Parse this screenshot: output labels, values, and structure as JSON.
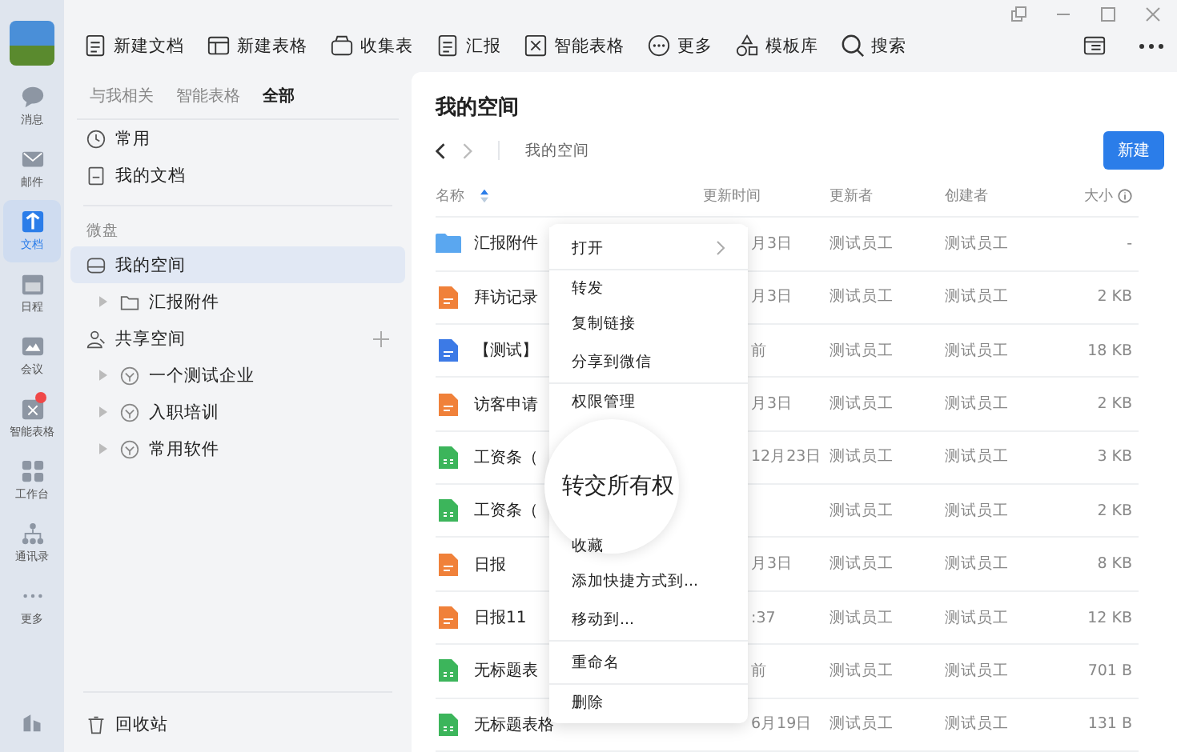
{
  "rail": [
    {
      "kind": "chat",
      "label": "消息",
      "selected": false,
      "badge": false
    },
    {
      "kind": "mail",
      "label": "邮件",
      "selected": false,
      "badge": false
    },
    {
      "kind": "doc",
      "label": "文档",
      "selected": true,
      "badge": false
    },
    {
      "kind": "calendar",
      "label": "日程",
      "selected": false,
      "badge": false
    },
    {
      "kind": "meeting",
      "label": "会议",
      "selected": false,
      "badge": false
    },
    {
      "kind": "sheet",
      "label": "智能表格",
      "selected": false,
      "badge": true
    },
    {
      "kind": "apps",
      "label": "工作台",
      "selected": false,
      "badge": false
    },
    {
      "kind": "contacts",
      "label": "通讯录",
      "selected": false,
      "badge": false
    },
    {
      "kind": "more",
      "label": "更多",
      "selected": false,
      "badge": false
    }
  ],
  "toolbar": [
    {
      "kind": "doc",
      "label": "新建文档"
    },
    {
      "kind": "table",
      "label": "新建表格"
    },
    {
      "kind": "bag",
      "label": "收集表"
    },
    {
      "kind": "report",
      "label": "汇报"
    },
    {
      "kind": "smart",
      "label": "智能表格"
    },
    {
      "kind": "more",
      "label": "更多"
    },
    {
      "kind": "shapes",
      "label": "模板库"
    },
    {
      "kind": "search",
      "label": "搜索"
    }
  ],
  "sidebar": {
    "tabs": [
      {
        "label": "与我相关",
        "selected": false
      },
      {
        "label": "智能表格",
        "selected": false
      },
      {
        "label": "全部",
        "selected": true
      }
    ],
    "quick": [
      {
        "kind": "clock",
        "label": "常用"
      },
      {
        "kind": "doc",
        "label": "我的文档"
      }
    ],
    "section": "微盘",
    "tree": [
      {
        "kind": "drive",
        "label": "我的空间",
        "selected": true,
        "add": false,
        "children": [
          {
            "kind": "folder",
            "label": "汇报附件",
            "selected": false
          }
        ]
      },
      {
        "kind": "shared",
        "label": "共享空间",
        "selected": false,
        "add": true,
        "children": [
          {
            "kind": "space",
            "label": "一个测试企业",
            "selected": false
          },
          {
            "kind": "space",
            "label": "入职培训",
            "selected": false
          },
          {
            "kind": "space",
            "label": "常用软件",
            "selected": false
          }
        ]
      }
    ],
    "trash": "回收站"
  },
  "main": {
    "title": "我的空间",
    "breadcrumb": "我的空间",
    "new_button": "新建",
    "columns": [
      "名称",
      "更新时间",
      "更新者",
      "创建者",
      "大小"
    ],
    "rows": [
      {
        "kind": "folder",
        "name": "汇报附件",
        "time": "月3日",
        "updater": "测试员工",
        "creator": "测试员工",
        "size": "-"
      },
      {
        "kind": "orange",
        "name": "拜访记录",
        "time": "月3日",
        "updater": "测试员工",
        "creator": "测试员工",
        "size": "2 KB"
      },
      {
        "kind": "blue",
        "name": "【测试】",
        "time": "前",
        "updater": "测试员工",
        "creator": "测试员工",
        "size": "18 KB"
      },
      {
        "kind": "orange",
        "name": "访客申请",
        "time": "月3日",
        "updater": "测试员工",
        "creator": "测试员工",
        "size": "2 KB"
      },
      {
        "kind": "green",
        "name": "工资条（",
        "time": "12月23日",
        "updater": "测试员工",
        "creator": "测试员工",
        "size": "3 KB"
      },
      {
        "kind": "green",
        "name": "工资条（",
        "updater": "测试员工",
        "creator": "测试员工",
        "size": "2 KB"
      },
      {
        "kind": "orange",
        "name": "日报",
        "time": "月3日",
        "updater": "测试员工",
        "creator": "测试员工",
        "size": "8 KB"
      },
      {
        "kind": "orange",
        "name": "日报11",
        "time": ":37",
        "updater": "测试员工",
        "creator": "测试员工",
        "size": "12 KB"
      },
      {
        "kind": "green",
        "name": "无标题表",
        "time": "前",
        "updater": "测试员工",
        "creator": "测试员工",
        "size": "701 B"
      },
      {
        "kind": "green",
        "name": "无标题表格",
        "time": "6月19日",
        "updater": "测试员工",
        "creator": "测试员工",
        "size": "131 B"
      }
    ]
  },
  "context_menu": [
    {
      "label": "打开",
      "submenu": true,
      "group_end": true
    },
    {
      "label": "转发",
      "submenu": false,
      "group_end": false
    },
    {
      "label": "复制链接",
      "submenu": false,
      "group_end": false
    },
    {
      "label": "分享到微信",
      "submenu": false,
      "group_end": true
    },
    {
      "label": "权限管理",
      "submenu": false,
      "group_end": false
    },
    {
      "label": "收藏",
      "submenu": false,
      "group_end": false
    },
    {
      "label": "添加快捷方式到...",
      "submenu": false,
      "group_end": false
    },
    {
      "label": "移动到...",
      "submenu": false,
      "group_end": true
    },
    {
      "label": "重命名",
      "submenu": false,
      "group_end": true
    },
    {
      "label": "删除",
      "submenu": false,
      "group_end": false
    }
  ],
  "magnifier": {
    "label": "转交所有权"
  }
}
